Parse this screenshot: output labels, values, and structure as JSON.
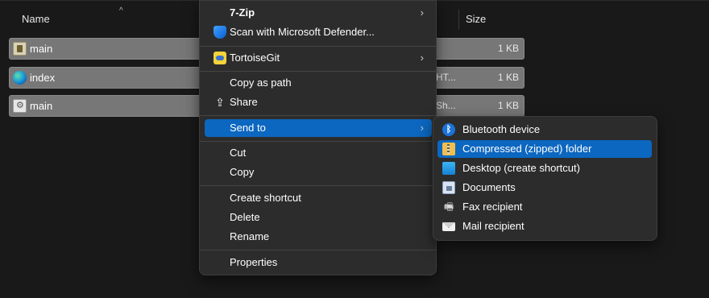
{
  "file_list": {
    "columns": {
      "name": "Name",
      "size": "Size"
    },
    "sort_indicator": "^",
    "rows": [
      {
        "name": "main",
        "type": "",
        "size": "1 KB",
        "icon": "script-file-icon"
      },
      {
        "name": "index",
        "type": "HT...",
        "size": "1 KB",
        "icon": "edge-html-icon"
      },
      {
        "name": "main",
        "type": "Sh...",
        "size": "1 KB",
        "icon": "settings-file-icon"
      }
    ]
  },
  "context_menu": {
    "items": [
      {
        "label": "7-Zip",
        "icon": "",
        "submenu": true
      },
      {
        "label": "Scan with Microsoft Defender...",
        "icon": "defender-shield-icon",
        "submenu": false
      },
      {
        "label": "TortoiseGit",
        "icon": "tortoisegit-icon",
        "submenu": true
      },
      {
        "label": "Copy as path",
        "icon": "",
        "submenu": false
      },
      {
        "label": "Share",
        "icon": "share-icon",
        "submenu": false
      },
      {
        "label": "Send to",
        "icon": "",
        "submenu": true,
        "highlighted": true
      },
      {
        "label": "Cut",
        "icon": "",
        "submenu": false
      },
      {
        "label": "Copy",
        "icon": "",
        "submenu": false
      },
      {
        "label": "Create shortcut",
        "icon": "",
        "submenu": false
      },
      {
        "label": "Delete",
        "icon": "",
        "submenu": false
      },
      {
        "label": "Rename",
        "icon": "",
        "submenu": false
      },
      {
        "label": "Properties",
        "icon": "",
        "submenu": false
      }
    ],
    "submenu_arrow": "›"
  },
  "send_to_menu": {
    "items": [
      {
        "label": "Bluetooth device",
        "icon": "bluetooth-icon"
      },
      {
        "label": "Compressed (zipped) folder",
        "icon": "zip-folder-icon",
        "highlighted": true
      },
      {
        "label": "Desktop (create shortcut)",
        "icon": "desktop-icon"
      },
      {
        "label": "Documents",
        "icon": "documents-icon"
      },
      {
        "label": "Fax recipient",
        "icon": "fax-icon"
      },
      {
        "label": "Mail recipient",
        "icon": "mail-icon"
      }
    ]
  },
  "colors": {
    "background": "#191919",
    "menu_background": "#2c2c2c",
    "highlight": "#0c67c0",
    "row_selected": "#777777"
  }
}
